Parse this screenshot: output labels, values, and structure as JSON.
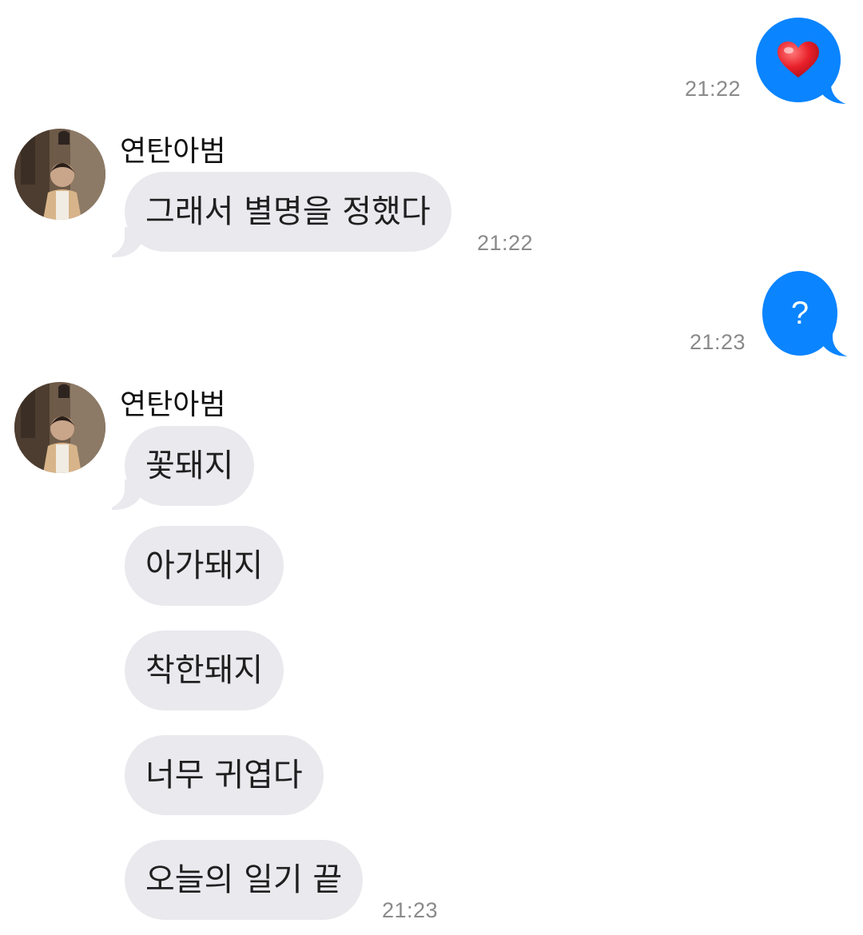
{
  "messages": {
    "out_1": {
      "content": "❤️",
      "icon": "heart-emoji",
      "time": "21:22"
    },
    "in_1": {
      "sender": "연탄아범",
      "text": "그래서 별명을 정했다",
      "time": "21:22"
    },
    "out_2": {
      "content": "?",
      "time": "21:23"
    },
    "in_2": {
      "sender": "연탄아범",
      "texts": [
        "꽃돼지",
        "아가돼지",
        "착한돼지",
        "너무 귀엽다",
        "오늘의 일기 끝"
      ],
      "time": "21:23"
    }
  },
  "colors": {
    "outgoing_bubble": "#0a84ff",
    "incoming_bubble": "#e9e9ee",
    "timestamp": "#8a8a8a"
  }
}
